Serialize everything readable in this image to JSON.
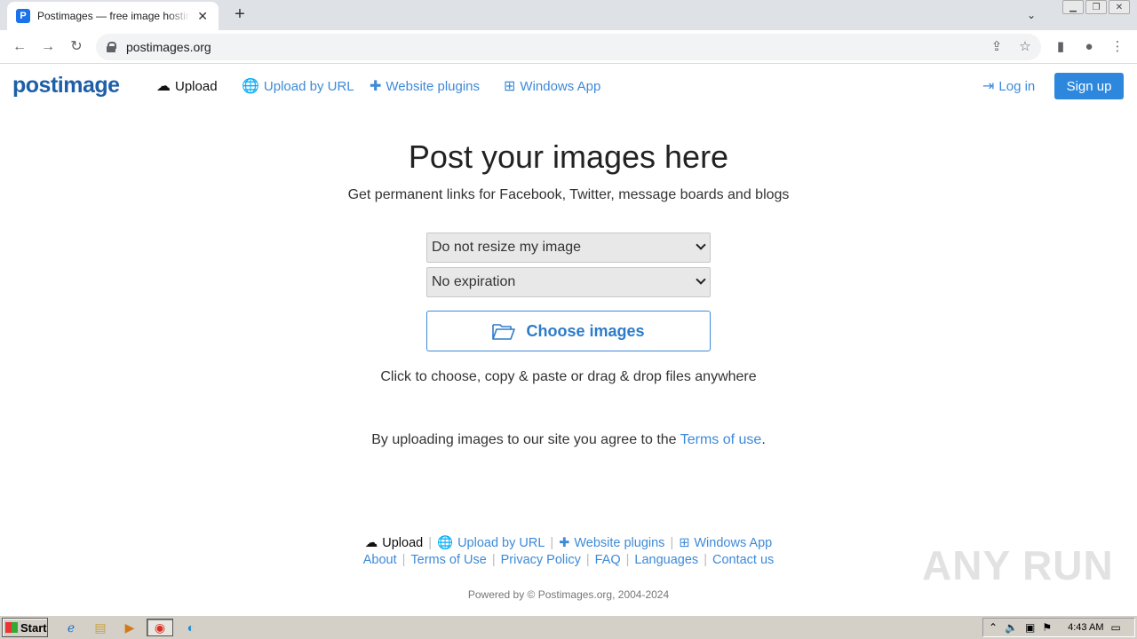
{
  "browser": {
    "tab_title": "Postimages — free image hosting / image upload",
    "tab_favicon": "P",
    "url": "postimages.org"
  },
  "nav": {
    "logo": "postimage",
    "upload": "Upload",
    "upload_by_url": "Upload by URL",
    "website_plugins": "Website plugins",
    "windows_app": "Windows App",
    "login": "Log in",
    "signup": "Sign up"
  },
  "main": {
    "headline": "Post your images here",
    "subhead": "Get permanent links for Facebook, Twitter, message boards and blogs",
    "resize_select": "Do not resize my image",
    "expiration_select": "No expiration",
    "choose_button": "Choose images",
    "hint": "Click to choose, copy & paste or drag & drop files anywhere",
    "terms_prefix": "By uploading images to our site you agree to the",
    "terms_link": "Terms of use",
    "terms_suffix": "."
  },
  "footer": {
    "row1": [
      "Upload",
      "Upload by URL",
      "Website plugins",
      "Windows App"
    ],
    "row2": [
      "About",
      "Terms of Use",
      "Privacy Policy",
      "FAQ",
      "Languages",
      "Contact us"
    ],
    "powered": "Powered by © Postimages.org, 2004-2024"
  },
  "watermark": "ANY RUN",
  "taskbar": {
    "start": "Start",
    "time": "4:43 AM"
  },
  "colors": {
    "link": "#3d8ad8",
    "signup_bg": "#2d88dd",
    "logo": "#1e5fa8"
  }
}
